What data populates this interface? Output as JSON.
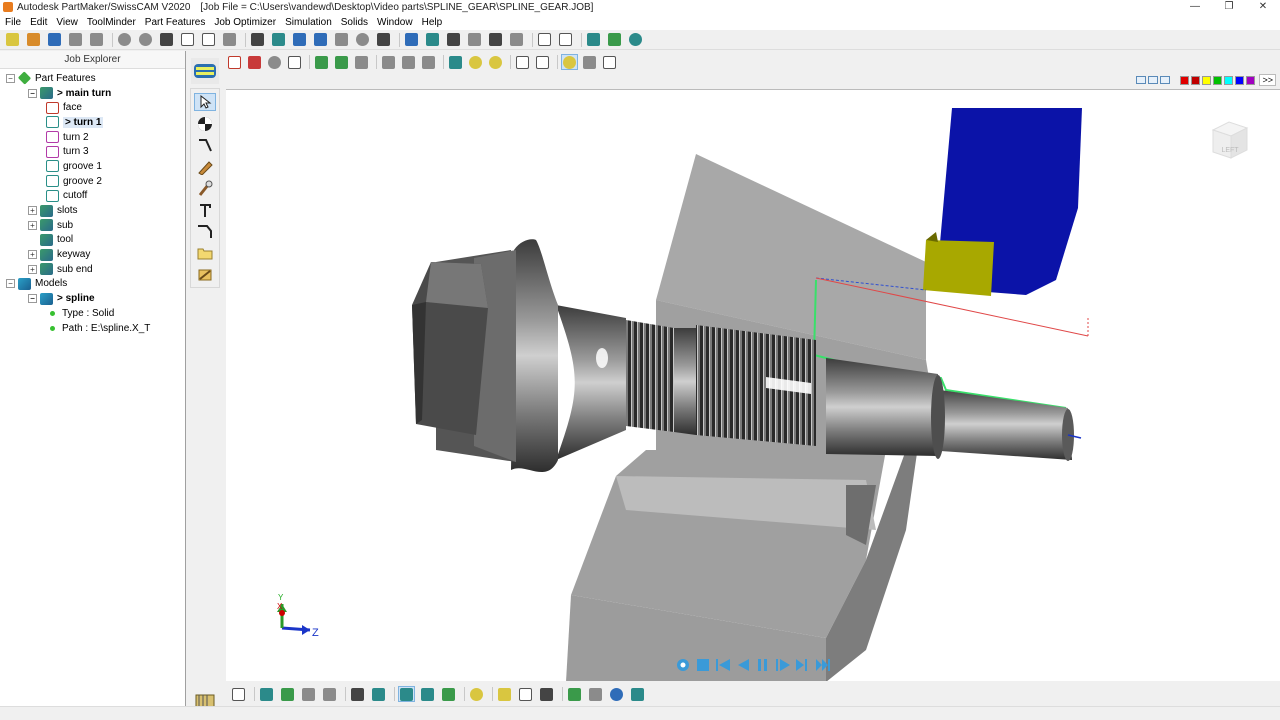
{
  "window": {
    "app_title": "Autodesk PartMaker/SwissCAM V2020",
    "job_file": "[Job File = C:\\Users\\vandewd\\Desktop\\Video parts\\SPLINE_GEAR\\SPLINE_GEAR.JOB]",
    "controls": {
      "minimize": "—",
      "restore": "❐",
      "close": "✕"
    }
  },
  "menu": [
    "File",
    "Edit",
    "View",
    "ToolMinder",
    "Part Features",
    "Job Optimizer",
    "Simulation",
    "Solids",
    "Window",
    "Help"
  ],
  "explorer": {
    "header": "Job Explorer",
    "tree": [
      {
        "label": "Part Features",
        "level": 0,
        "expander": "−",
        "icon": "green-diamond"
      },
      {
        "label": "> main turn",
        "level": 1,
        "expander": "−",
        "icon": "group",
        "bold": true
      },
      {
        "label": "face",
        "level": 2,
        "icon": "feature-red"
      },
      {
        "label": "> turn 1",
        "level": 2,
        "icon": "feature-teal",
        "bold": true,
        "selected": true
      },
      {
        "label": "turn 2",
        "level": 2,
        "icon": "feature-pink"
      },
      {
        "label": "turn 3",
        "level": 2,
        "icon": "feature-pink"
      },
      {
        "label": "groove 1",
        "level": 2,
        "icon": "feature-teal"
      },
      {
        "label": "groove 2",
        "level": 2,
        "icon": "feature-teal"
      },
      {
        "label": "cutoff",
        "level": 2,
        "icon": "feature-teal"
      },
      {
        "label": "slots",
        "level": 1,
        "expander": "+",
        "icon": "group"
      },
      {
        "label": "sub",
        "level": 1,
        "expander": "+",
        "icon": "group"
      },
      {
        "label": "tool",
        "level": 1,
        "expander": "",
        "icon": "group"
      },
      {
        "label": "keyway",
        "level": 1,
        "expander": "+",
        "icon": "group"
      },
      {
        "label": "sub end",
        "level": 1,
        "expander": "+",
        "icon": "group"
      },
      {
        "label": "Models",
        "level": 0,
        "expander": "−",
        "icon": "model"
      },
      {
        "label": "> spline",
        "level": 1,
        "expander": "−",
        "icon": "model",
        "bold": true
      },
      {
        "label": "Type : Solid",
        "level": 2,
        "icon": "bullet"
      },
      {
        "label": "Path : E:\\spline.X_T",
        "level": 2,
        "icon": "bullet"
      }
    ]
  },
  "viewport": {
    "view_cube_label": "LEFT",
    "axis_labels": {
      "x": "X",
      "y": "Y",
      "z": "Z"
    }
  },
  "colors": {
    "accent": "#2f6cb8",
    "tool_holder": "#0b13a8",
    "insert": "#a8a800",
    "toolpath": "#39e06a",
    "swatches": [
      "#e00000",
      "#c00000",
      "#ffff00",
      "#00c000",
      "#00ffff",
      "#0000ff",
      "#a000c0"
    ]
  }
}
